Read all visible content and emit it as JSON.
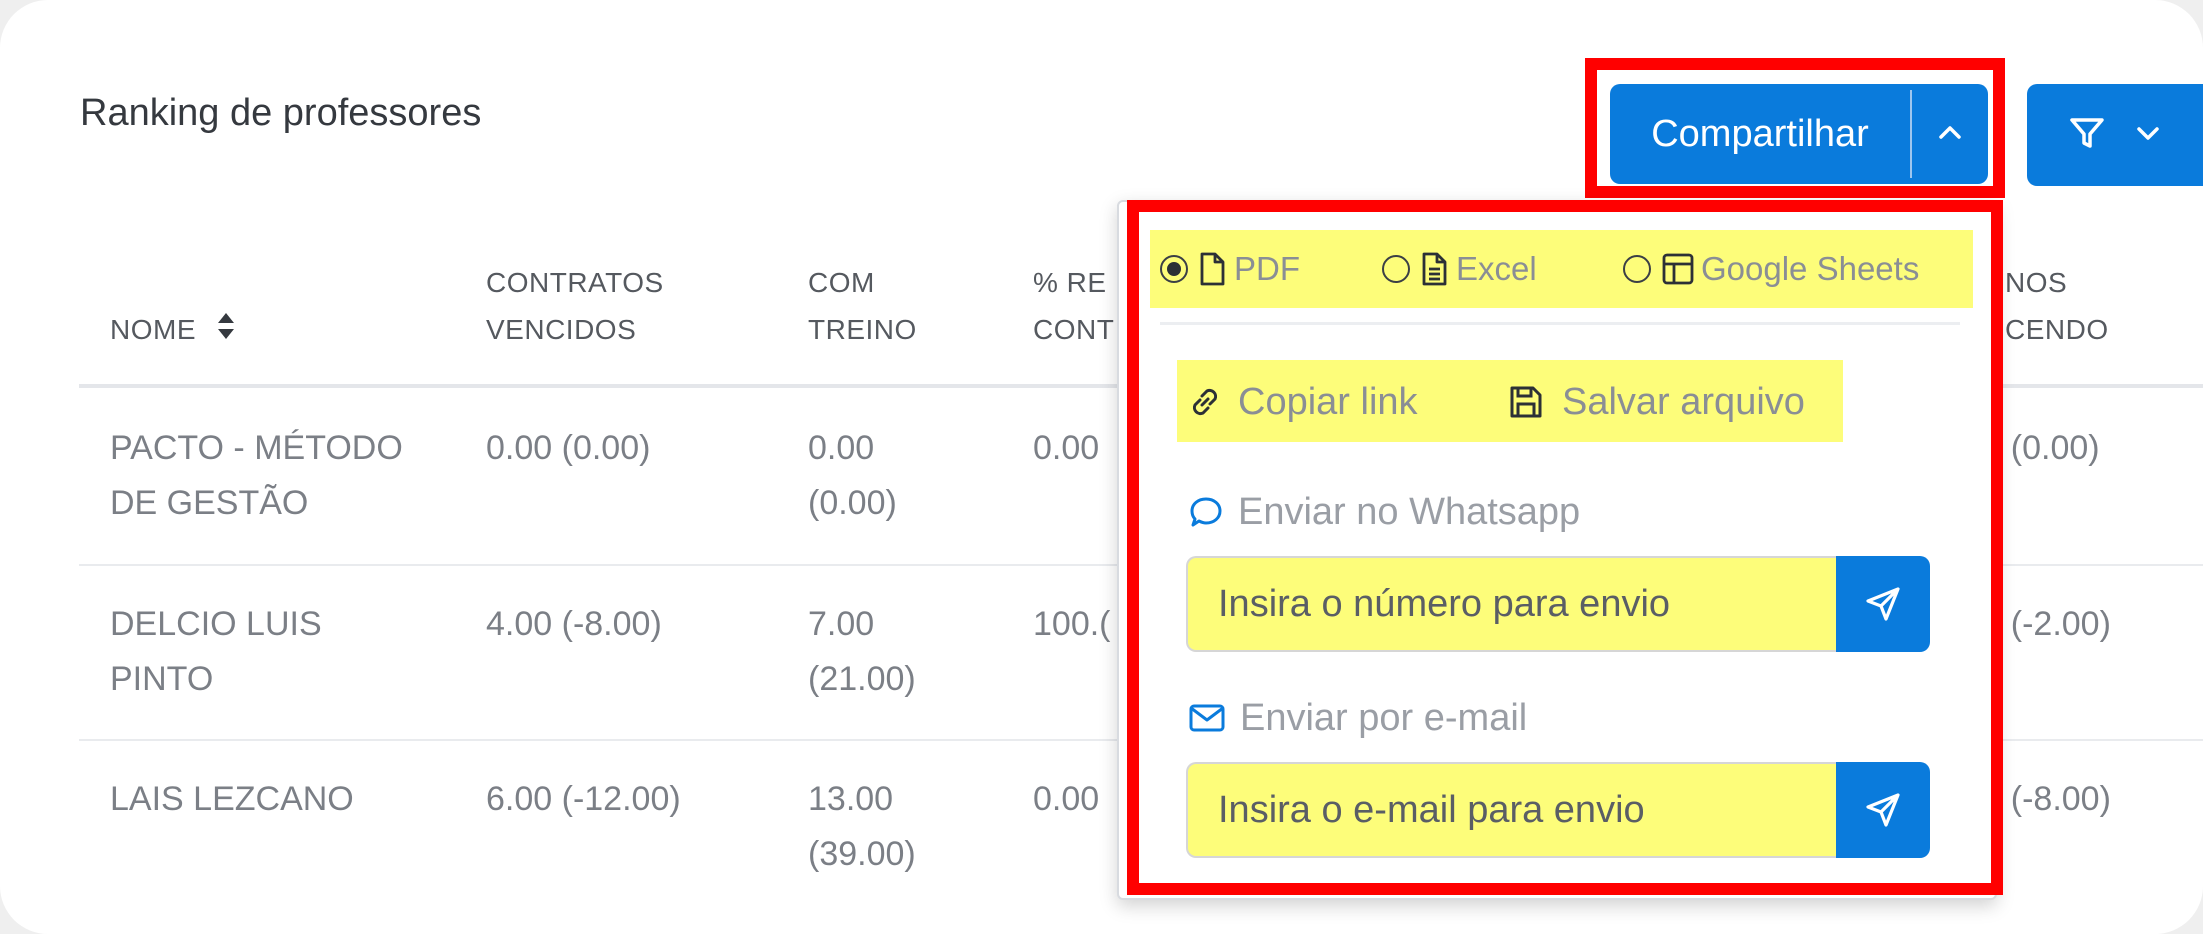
{
  "page": {
    "title": "Ranking de professores"
  },
  "toolbar": {
    "share_label": "Compartilhar",
    "caret_icon": "chevron-up-icon",
    "filter_icon": "filter-icon",
    "filter_caret_icon": "chevron-down-icon"
  },
  "table": {
    "headers": {
      "nome": "NOME",
      "col1_l1": "CONTRATOS",
      "col1_l2": "VENCIDOS",
      "col2_l1": "COM",
      "col2_l2": "TREINO",
      "col3_l1": "% RE",
      "col3_l2": "CONT",
      "col4_l1": "NOS",
      "col4_l2": "CENDO"
    },
    "rows": [
      {
        "nome_l1": "PACTO - MÉTODO",
        "nome_l2": "DE GESTÃO",
        "c1": "0.00 (0.00)",
        "c2_l1": "0.00",
        "c2_l2": "(0.00)",
        "c3": "0.00",
        "c4": ") (0.00)"
      },
      {
        "nome_l1": "DELCIO LUIS",
        "nome_l2": "PINTO",
        "c1": "4.00 (-8.00)",
        "c2_l1": "7.00",
        "c2_l2": "(21.00)",
        "c3": "100.(",
        "c4": ") (-2.00)"
      },
      {
        "nome_l1": "LAIS LEZCANO",
        "nome_l2": "",
        "c1": "6.00 (-12.00)",
        "c2_l1": "13.00",
        "c2_l2": "(39.00)",
        "c3": "0.00",
        "c4": ") (-8.00)"
      }
    ]
  },
  "share_menu": {
    "formats": [
      {
        "label": "PDF",
        "icon": "file-icon",
        "selected": true
      },
      {
        "label": "Excel",
        "icon": "file-text-icon",
        "selected": false
      },
      {
        "label": "Google Sheets",
        "icon": "table-icon",
        "selected": false
      }
    ],
    "copy_link_label": "Copiar link",
    "save_file_label": "Salvar arquivo",
    "whatsapp_label": "Enviar no Whatsapp",
    "whatsapp_placeholder": "Insira o número para envio",
    "email_label": "Enviar por e-mail",
    "email_placeholder": "Insira o e-mail para envio"
  },
  "colors": {
    "primary": "#0a7bdc",
    "highlight": "#fdfd7a",
    "annotation_red": "#ff0000"
  }
}
